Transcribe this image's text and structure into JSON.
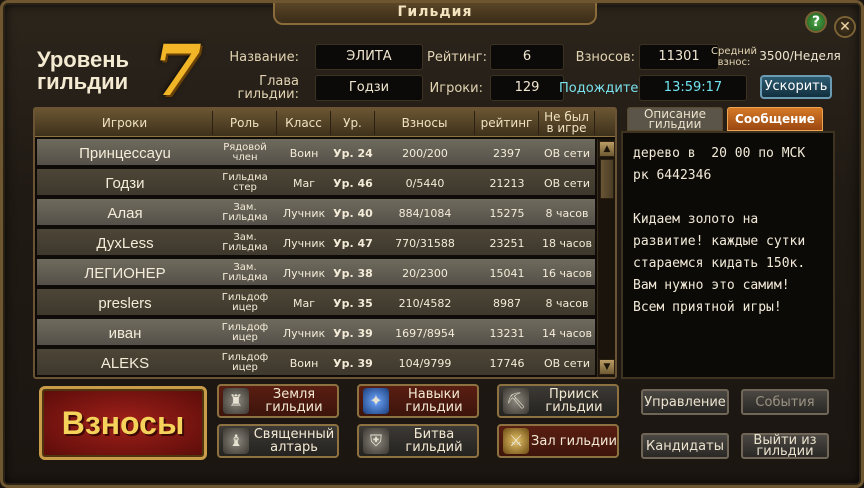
{
  "window": {
    "title": "Гильдия",
    "help_label": "?",
    "close_label": "✕"
  },
  "guild": {
    "level_label": "Уровень гильдии",
    "level": "7",
    "name_label": "Название:",
    "name": "ЭЛИТА",
    "leader_label": "Глава гильдии:",
    "leader": "Годзи",
    "rating_label": "Рейтинг:",
    "rating": "6",
    "players_label": "Игроки:",
    "players": "129",
    "contrib_label": "Взносов:",
    "contrib": "11301",
    "avg_label": "Средний взнос:",
    "avg": "3500/Неделя",
    "wait_label": "Подождите:",
    "wait_timer": "13:59:17",
    "speedup_label": "Ускорить"
  },
  "table": {
    "headers": [
      "Игроки",
      "Роль",
      "Класс",
      "Ур.",
      "Взносы",
      "рейтинг",
      "Не был в игре"
    ],
    "rows": [
      {
        "name": "Принцессаyu",
        "role": "Рядовой член",
        "class": "Воин",
        "level": "Ур. 24",
        "contrib": "200/200",
        "rating": "2397",
        "last": "ОВ сети"
      },
      {
        "name": "Годзи",
        "role": "Гильдма стер",
        "class": "Маг",
        "level": "Ур. 46",
        "contrib": "0/5440",
        "rating": "21213",
        "last": "ОВ сети"
      },
      {
        "name": "Алая",
        "role": "Зам. Гильдма",
        "class": "Лучник",
        "level": "Ур. 40",
        "contrib": "884/1084",
        "rating": "15275",
        "last": "8 часов"
      },
      {
        "name": "ДухLess",
        "role": "Зам. Гильдма",
        "class": "Лучник",
        "level": "Ур. 47",
        "contrib": "770/31588",
        "rating": "23251",
        "last": "18 часов"
      },
      {
        "name": "ЛЕГИОНЕР",
        "role": "Зам. Гильдма",
        "class": "Лучник",
        "level": "Ур. 38",
        "contrib": "20/2300",
        "rating": "15041",
        "last": "16 часов"
      },
      {
        "name": "preslers",
        "role": "Гильдоф ицер",
        "class": "Маг",
        "level": "Ур. 35",
        "contrib": "210/4582",
        "rating": "8987",
        "last": "8 часов"
      },
      {
        "name": "иван",
        "role": "Гильдоф ицер",
        "class": "Лучник",
        "level": "Ур. 39",
        "contrib": "1697/8954",
        "rating": "13231",
        "last": "14 часов"
      },
      {
        "name": "ALEKS",
        "role": "Гильдоф ицер",
        "class": "Воин",
        "level": "Ур. 39",
        "contrib": "104/9799",
        "rating": "17746",
        "last": "ОВ сети"
      }
    ]
  },
  "tabs": {
    "description": "Описание гильдии",
    "message": "Сообщение"
  },
  "message_text": "дерево в  20 00 по МСК\nрк 6442346\n\nКидаем золото на\nразвитие! каждые сутки\nстараемся кидать 150к.\nВам нужно это самим!\nВсем приятной игры!",
  "buttons": {
    "contribute": "Взносы",
    "land": "Земля гильдии",
    "skills": "Навыки гильдии",
    "mine": "Прииск гильдии",
    "altar": "Священный алтарь",
    "battle": "Битва гильдий",
    "hall": "Зал гильдии",
    "manage": "Управление",
    "events": "События",
    "candidates": "Кандидаты",
    "leave": "Выйти из гильдии"
  },
  "icons": {
    "land": "castle-icon",
    "skills": "star-orb-icon",
    "mine": "cart-icon",
    "altar": "statue-icon",
    "battle": "shield-icon",
    "hall": "swords-icon"
  }
}
